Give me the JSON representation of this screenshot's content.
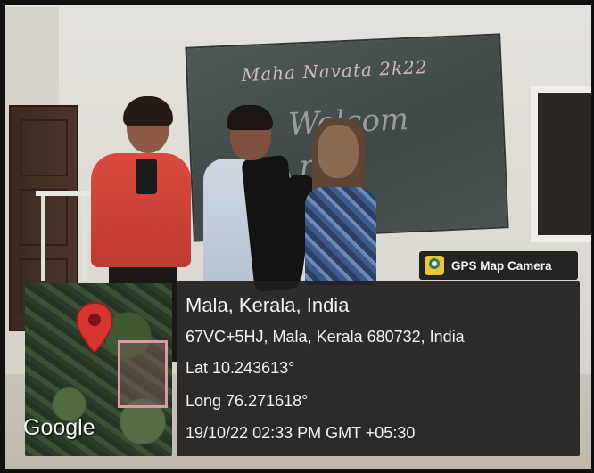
{
  "scene": {
    "board_text": "Maha Navata 2k22",
    "board_scrawl_1": "Welcom",
    "board_scrawl_2": "rush"
  },
  "badge": {
    "icon": "gps-map-camera-icon",
    "label": "GPS Map Camera"
  },
  "map": {
    "logo": "Google",
    "pin_icon": "map-pin-icon",
    "pin_color": "#d6342c"
  },
  "location": {
    "title": "Mala, Kerala, India",
    "address": "67VC+5HJ, Mala, Kerala 680732, India",
    "latitude": "Lat 10.243613°",
    "longitude": "Long 76.271618°",
    "timestamp": "19/10/22 02:33 PM GMT +05:30"
  }
}
